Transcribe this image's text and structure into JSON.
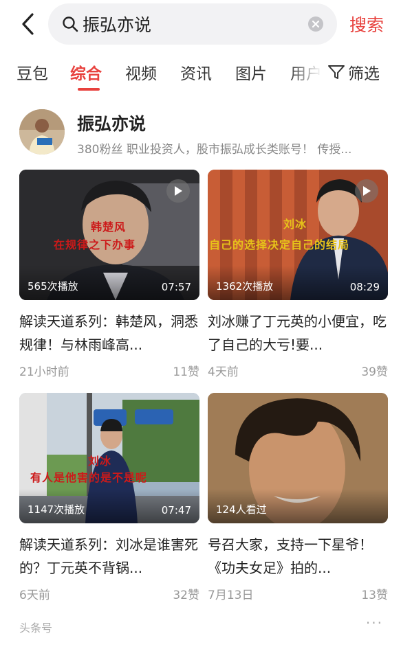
{
  "header": {
    "query": "振弘亦说",
    "search_label": "搜索"
  },
  "tabs": [
    {
      "label": "豆包"
    },
    {
      "label": "综合"
    },
    {
      "label": "视频"
    },
    {
      "label": "资讯"
    },
    {
      "label": "图片"
    },
    {
      "label": "用户"
    }
  ],
  "filter_label": "筛选",
  "account": {
    "name": "振弘亦说",
    "desc": "380粉丝  职业投资人，股市振弘成长类账号！ 传授..."
  },
  "cards": [
    {
      "plays": "565次播放",
      "duration": "07:57",
      "sub1": "韩楚风",
      "sub2": "在规律之下办事",
      "title": "解读天道系列：韩楚风，洞悉规律！与林雨峰高...",
      "time": "21小时前",
      "likes": "11赞"
    },
    {
      "plays": "1362次播放",
      "duration": "08:29",
      "sub1": "刘冰",
      "sub2": "自己的选择决定自己的结局",
      "title": "刘冰赚了丁元英的小便宜，吃了自己的大亏!要...",
      "time": "4天前",
      "likes": "39赞"
    },
    {
      "plays": "1147次播放",
      "duration": "07:47",
      "sub1": "刘冰",
      "sub2": "有人是他害的是不是呢",
      "title": "解读天道系列：刘冰是谁害死的？丁元英不背锅...",
      "time": "6天前",
      "likes": "32赞"
    },
    {
      "plays": "124人看过",
      "duration": "",
      "sub1": "",
      "sub2": "",
      "title": "号召大家，支持一下星爷！《功夫女足》拍的...",
      "time": "7月13日",
      "likes": "13赞"
    }
  ],
  "footer": {
    "source": "头条号",
    "more": "···"
  },
  "colors": {
    "accent": "#e8413d",
    "muted": "#999999"
  }
}
